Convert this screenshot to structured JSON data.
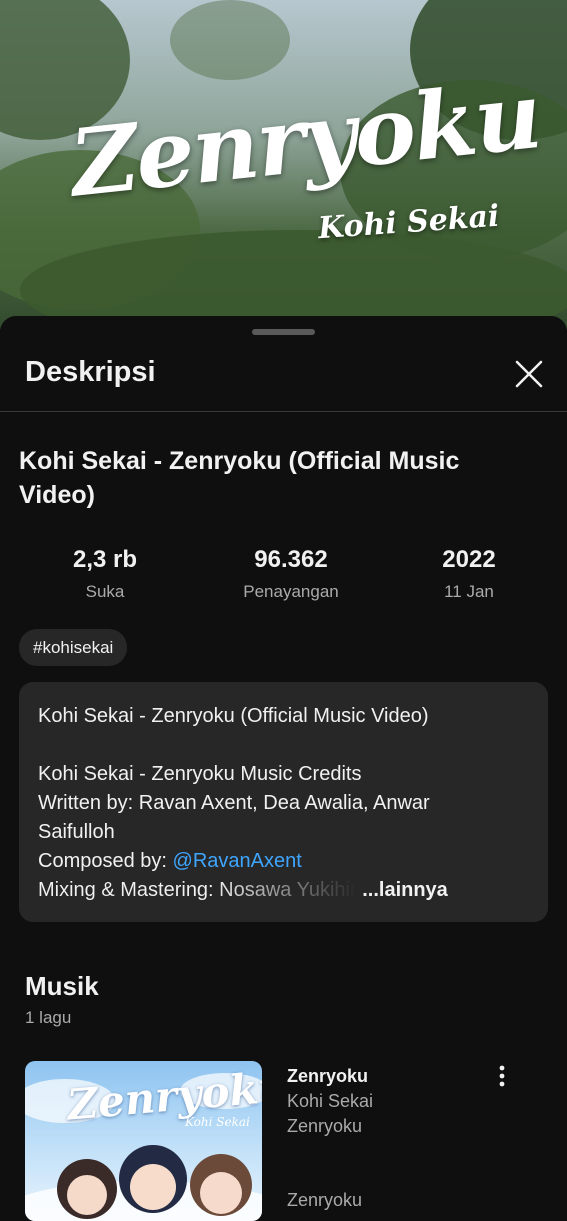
{
  "video": {
    "title_art": "Zenryoku",
    "subtitle_art": "Kohi Sekai"
  },
  "sheet": {
    "title": "Deskripsi",
    "close_icon": "close-icon"
  },
  "video_title": "Kohi Sekai - Zenryoku (Official Music Video)",
  "stats": [
    {
      "value": "2,3 rb",
      "label": "Suka"
    },
    {
      "value": "96.362",
      "label": "Penayangan"
    },
    {
      "value": "2022",
      "label": "11 Jan"
    }
  ],
  "hashtag": "#kohisekai",
  "description": {
    "line1": "Kohi Sekai - Zenryoku (Official Music Video)",
    "line2": "Kohi Sekai - Zenryoku  Music Credits",
    "line3": "Written by: Ravan Axent, Dea Awalia, Anwar",
    "line4": "Saifulloh",
    "line5_prefix": "Composed by: ",
    "line5_link": "@RavanAxent",
    "line6": "Mixing & Mastering: Nosawa Yukihir",
    "more": "...lainnya"
  },
  "music": {
    "title": "Musik",
    "count": "1 lagu",
    "song": {
      "thumb_title": "Zenryoku",
      "thumb_subtitle": "Kohi Sekai",
      "name": "Zenryoku",
      "artist": "Kohi Sekai",
      "album": "Zenryoku",
      "cut_line": "Zenryoku"
    }
  },
  "colors": {
    "background": "#0f0f0f",
    "card": "#272727",
    "link": "#3ea6ff",
    "secondary_text": "#aaaaaa"
  }
}
